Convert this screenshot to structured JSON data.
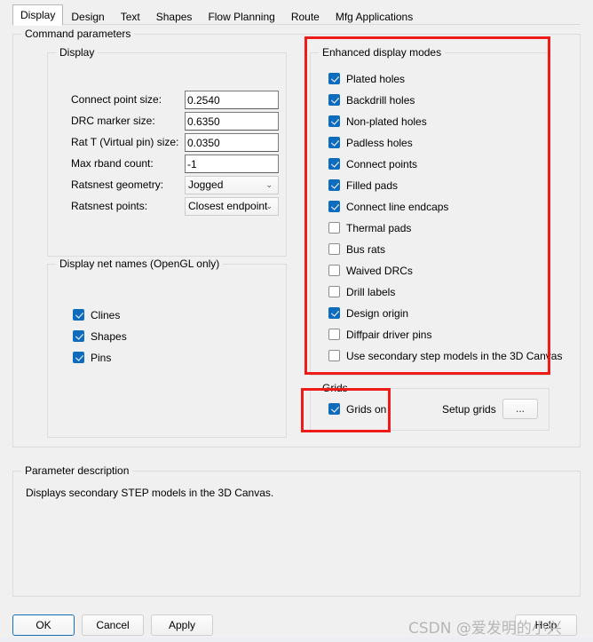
{
  "tabs": [
    {
      "label": "Display",
      "selected": true
    },
    {
      "label": "Design",
      "selected": false
    },
    {
      "label": "Text",
      "selected": false
    },
    {
      "label": "Shapes",
      "selected": false
    },
    {
      "label": "Flow Planning",
      "selected": false
    },
    {
      "label": "Route",
      "selected": false
    },
    {
      "label": "Mfg Applications",
      "selected": false
    }
  ],
  "command_parameters": {
    "title": "Command parameters"
  },
  "display_group": {
    "title": "Display",
    "fields": [
      {
        "label": "Connect point size:",
        "type": "text",
        "value": "0.2540"
      },
      {
        "label": "DRC marker size:",
        "type": "text",
        "value": "0.6350"
      },
      {
        "label": "Rat T (Virtual pin) size:",
        "type": "text",
        "value": "0.0350"
      },
      {
        "label": "Max rband count:",
        "type": "text",
        "value": "-1"
      },
      {
        "label": "Ratsnest geometry:",
        "type": "combo",
        "value": "Jogged"
      },
      {
        "label": "Ratsnest points:",
        "type": "combo",
        "value": "Closest endpoint"
      }
    ]
  },
  "net_names_group": {
    "title": "Display net names (OpenGL only)",
    "items": [
      {
        "label": "Clines",
        "checked": true
      },
      {
        "label": "Shapes",
        "checked": true
      },
      {
        "label": "Pins",
        "checked": true
      }
    ]
  },
  "enhanced_group": {
    "title": "Enhanced display modes",
    "items": [
      {
        "label": "Plated holes",
        "checked": true
      },
      {
        "label": "Backdrill holes",
        "checked": true
      },
      {
        "label": "Non-plated holes",
        "checked": true
      },
      {
        "label": "Padless holes",
        "checked": true
      },
      {
        "label": "Connect points",
        "checked": true
      },
      {
        "label": "Filled pads",
        "checked": true
      },
      {
        "label": "Connect line endcaps",
        "checked": true
      },
      {
        "label": "Thermal pads",
        "checked": false
      },
      {
        "label": "Bus rats",
        "checked": false
      },
      {
        "label": "Waived DRCs",
        "checked": false
      },
      {
        "label": "Drill labels",
        "checked": false
      },
      {
        "label": "Design origin",
        "checked": true
      },
      {
        "label": "Diffpair driver pins",
        "checked": false
      },
      {
        "label": "Use secondary step models in the 3D Canvas",
        "checked": false
      }
    ]
  },
  "grids_group": {
    "title": "Grids",
    "grids_on": {
      "label": "Grids on",
      "checked": true
    },
    "setup_grids_label": "Setup grids",
    "setup_grids_button": "..."
  },
  "parameter_description": {
    "title": "Parameter description",
    "text": "Displays secondary STEP models in the 3D Canvas."
  },
  "buttons": {
    "ok": "OK",
    "cancel": "Cancel",
    "apply": "Apply",
    "help": "Help"
  },
  "watermark": "CSDN @爱发明的小兴",
  "colors": {
    "accent": "#0f6cbd",
    "annotation_red": "#ef1b18",
    "window_background": "#f0f0f0",
    "groupbox_border": "#dcdcdc"
  }
}
